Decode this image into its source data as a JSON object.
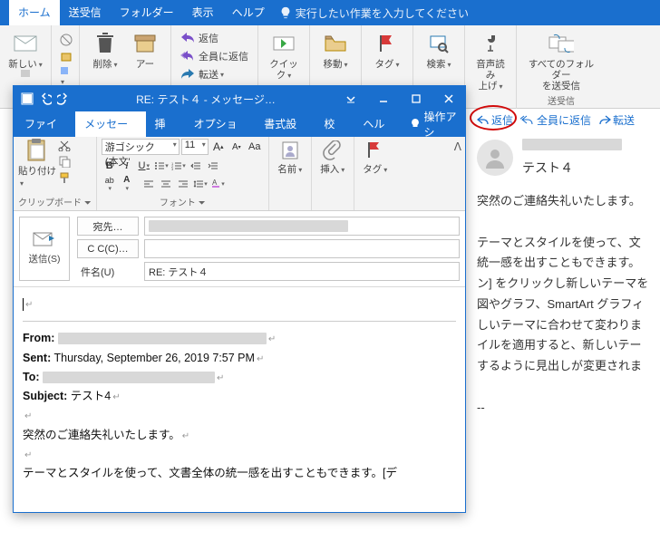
{
  "main": {
    "tabs": [
      "ホーム",
      "送受信",
      "フォルダー",
      "表示",
      "ヘルプ"
    ],
    "active_tab": "ホーム",
    "tell_me": "実行したい作業を入力してください",
    "ribbon": {
      "new": {
        "label": "新しい"
      },
      "delete": {
        "label": "削除"
      },
      "archive": {
        "label": "アー"
      },
      "reply": "返信",
      "reply_all": "全員に返信",
      "forward": "転送",
      "quick_steps": "クイック",
      "move": "移動",
      "tag": "タグ",
      "search": "検索",
      "read_aloud": {
        "l1": "音声読み",
        "l2": "上げ"
      },
      "send_receive": {
        "l1": "すべてのフォルダー",
        "l2": "を送受信",
        "grp": "送受信"
      }
    }
  },
  "reading": {
    "actions": {
      "reply": "返信",
      "reply_all": "全員に返信",
      "forward": "転送"
    },
    "subject": "テスト４",
    "body_lines": [
      "突然のご連絡失礼いたします。",
      "",
      "テーマとスタイルを使って、文",
      "統一感を出すこともできます。",
      "ン] をクリックし新しいテーマを",
      "図やグラフ、SmartArt グラフィ",
      "しいテーマに合わせて変わりま",
      "イルを適用すると、新しいテー",
      "するように見出しが変更されま",
      "",
      "--"
    ]
  },
  "msg": {
    "title": "RE: テスト４  -  メッセージ…",
    "tabs": [
      "ファイル",
      "メッセージ",
      "挿入",
      "オプション",
      "書式設定",
      "校閲",
      "ヘルプ"
    ],
    "active_tab": "メッセージ",
    "tell_me": "操作アシ",
    "ribbon": {
      "paste": "貼り付け",
      "clipboard_grp": "クリップボード",
      "font_name": "游ゴシック (本文'",
      "font_size": "11",
      "font_grp": "フォント",
      "names": "名前",
      "insert": "挿入",
      "tag": "タグ"
    },
    "compose": {
      "send": "送信(S)",
      "to_btn": "宛先…",
      "cc_btn": "C C(C)…",
      "subject_lbl": "件名(U)",
      "subject": "RE: テスト４"
    },
    "quoted": {
      "from_lbl": "From:",
      "sent_lbl": "Sent:",
      "sent_val": "Thursday, September 26, 2019 7:57 PM",
      "to_lbl": "To:",
      "subject_lbl": "Subject:",
      "subject_val": "テスト4",
      "body1": "突然のご連絡失礼いたします。",
      "body2": "テーマとスタイルを使って、文書全体の統一感を出すこともできます。[デ"
    }
  }
}
